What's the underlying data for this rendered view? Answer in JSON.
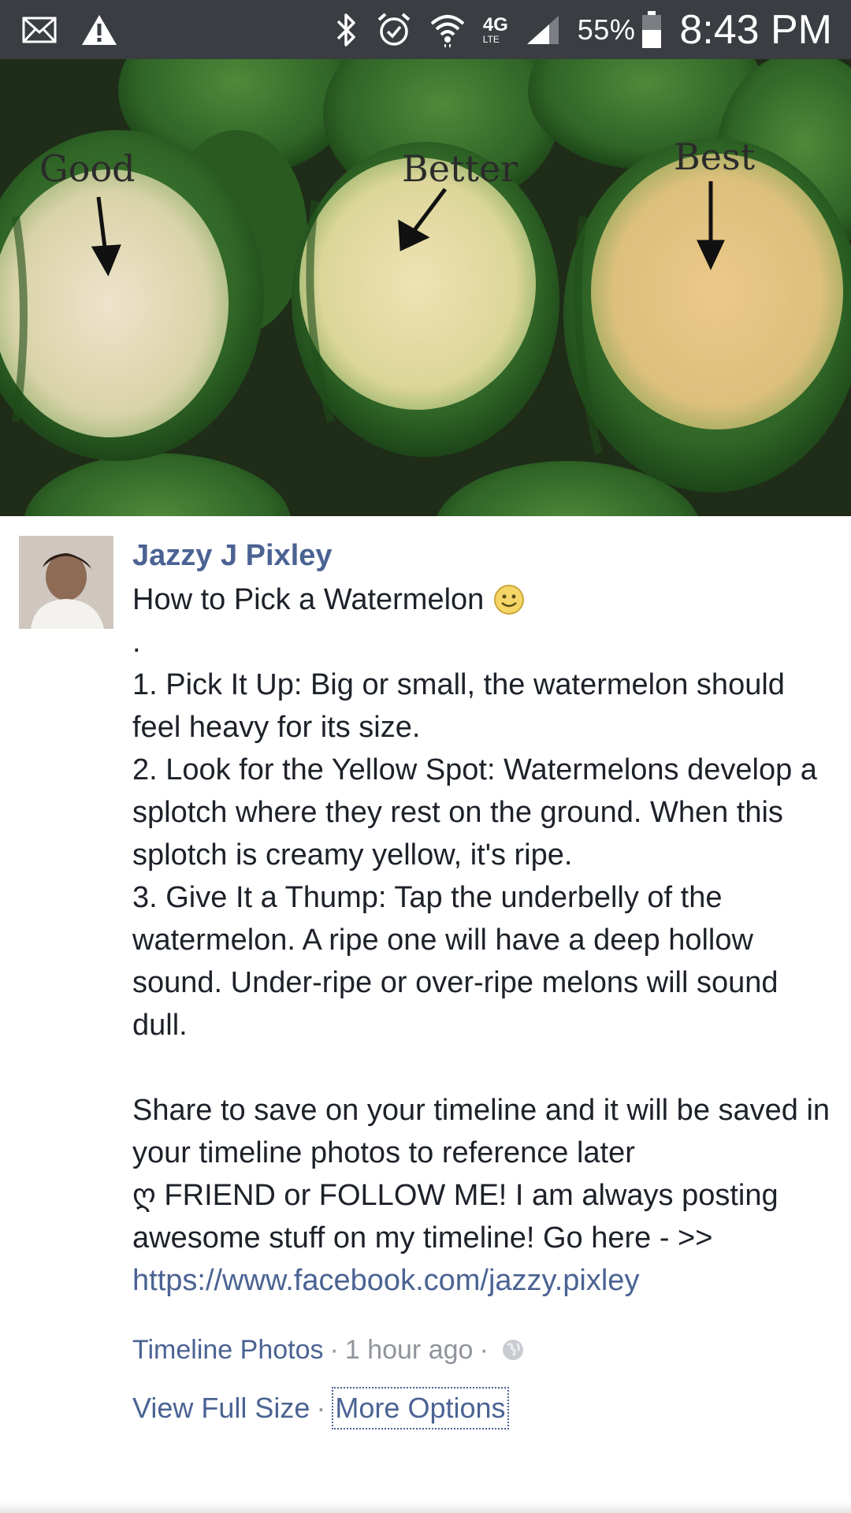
{
  "status_bar": {
    "network": "4G",
    "network_sub": "LTE",
    "battery": "55%",
    "time": "8:43 PM",
    "icons": [
      "mail-icon",
      "warning-icon",
      "bluetooth-icon",
      "alarm-icon",
      "wifi-icon",
      "signal-icon",
      "battery-icon"
    ]
  },
  "photo": {
    "labels": [
      "Good",
      "Better",
      "Best"
    ],
    "alt_subject": "three watermelons with ground spots"
  },
  "post": {
    "author": "Jazzy J Pixley",
    "title": "How to Pick a Watermelon",
    "emoji": "smiley-icon",
    "body": ".\n1. Pick It Up: Big or small, the watermelon should feel heavy for its size.\n2. Look for the Yellow Spot: Watermelons develop a splotch where they rest on the ground. When this splotch is creamy yellow, it's ripe.\n3. Give It a Thump: Tap the underbelly of the watermelon. A ripe one will have a deep hollow sound. Under-ripe or over-ripe melons will sound dull.\n\nShare to save on your timeline and it will be saved in your timeline photos to reference later\n",
    "friend_text": "ღ FRIEND or FOLLOW ME! I am always posting awesome stuff on my timeline! Go here - >>",
    "link": "https://www.facebook.com/jazzy.pixley"
  },
  "meta": {
    "album": "Timeline Photos",
    "time_ago": "1 hour ago",
    "privacy_icon": "globe-icon"
  },
  "actions": {
    "view_full_size": "View Full Size",
    "more_options": "More Options"
  },
  "colors": {
    "status_bar": "#3a3d42",
    "link_blue": "#4b6393",
    "meta_gray": "#90949c"
  }
}
